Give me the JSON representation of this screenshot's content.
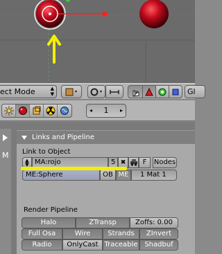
{
  "viewport": {
    "selected_object_color": "#b3081a",
    "other_object_color": "#b00414",
    "annotation_color": "#f4f000"
  },
  "header3d": {
    "mode_label": "ect Mode",
    "gl_label": "Gl"
  },
  "btnheader": {
    "frame_value": "1",
    "frame_left": "◂",
    "frame_right": "▸"
  },
  "sidetabs": {
    "tab_label": "M"
  },
  "links_panel": {
    "title": "Links and Pipeline",
    "link_to_object_label": "Link to Object",
    "material_name": "MA:rojo",
    "user_count": "5",
    "x_button": "✖",
    "f_button": "F",
    "nodes_button": "Nodes",
    "mesh_name": "ME:Sphere",
    "ob_button": "OB",
    "me_button": "ME",
    "mat_index": "1 Mat 1",
    "render_pipeline_label": "Render Pipeline",
    "pipeline_buttons": {
      "halo": "Halo",
      "ztransp": "ZTransp",
      "zoffs": "Zoffs: 0.00",
      "full_osa": "Full Osa",
      "wire": "Wire",
      "strands": "Strands",
      "zinvert": "ZInvert",
      "radio": "Radio",
      "only_cast": "OnlyCast",
      "traceable": "Traceable",
      "shadbuf": "Shadbuf"
    }
  }
}
